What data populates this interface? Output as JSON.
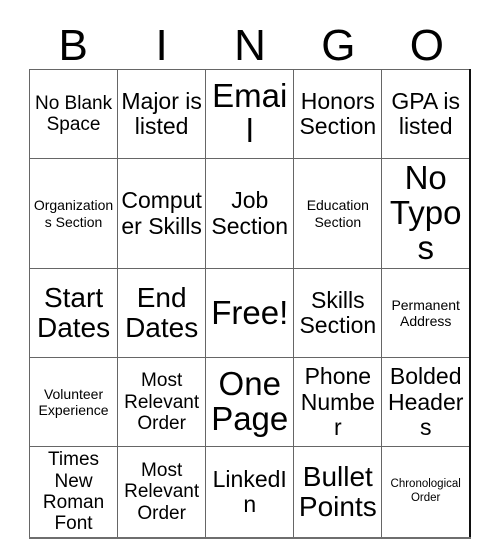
{
  "card": {
    "title": "BINGO",
    "header_letters": [
      "B",
      "I",
      "N",
      "G",
      "O"
    ],
    "rows": [
      [
        {
          "text": "No Blank Space",
          "size": "m"
        },
        {
          "text": "Major is listed",
          "size": "l"
        },
        {
          "text": "Email",
          "size": "xxl"
        },
        {
          "text": "Honors Section",
          "size": "l"
        },
        {
          "text": "GPA is listed",
          "size": "l"
        }
      ],
      [
        {
          "text": "Organizations Section",
          "size": "s"
        },
        {
          "text": "Computer Skills",
          "size": "l"
        },
        {
          "text": "Job Section",
          "size": "l"
        },
        {
          "text": "Education Section",
          "size": "s"
        },
        {
          "text": "No Typos",
          "size": "xxl"
        }
      ],
      [
        {
          "text": "Start Dates",
          "size": "xl"
        },
        {
          "text": "End Dates",
          "size": "xl"
        },
        {
          "text": "Free!",
          "size": "xxl"
        },
        {
          "text": "Skills Section",
          "size": "l"
        },
        {
          "text": "Permanent Address",
          "size": "s"
        }
      ],
      [
        {
          "text": "Volunteer Experience",
          "size": "s"
        },
        {
          "text": "Most Relevant Order",
          "size": "m"
        },
        {
          "text": "One Page",
          "size": "xxl"
        },
        {
          "text": "Phone Number",
          "size": "l"
        },
        {
          "text": "Bolded Headers",
          "size": "l"
        }
      ],
      [
        {
          "text": "Times New Roman Font",
          "size": "m"
        },
        {
          "text": "Most Relevant Order",
          "size": "m"
        },
        {
          "text": "LinkedIn",
          "size": "l"
        },
        {
          "text": "Bullet Points",
          "size": "xl"
        },
        {
          "text": "Chronological Order",
          "size": "xs"
        }
      ]
    ]
  },
  "colors": {
    "background": "#ffffff",
    "text": "#000000",
    "grid_line": "#666666"
  }
}
